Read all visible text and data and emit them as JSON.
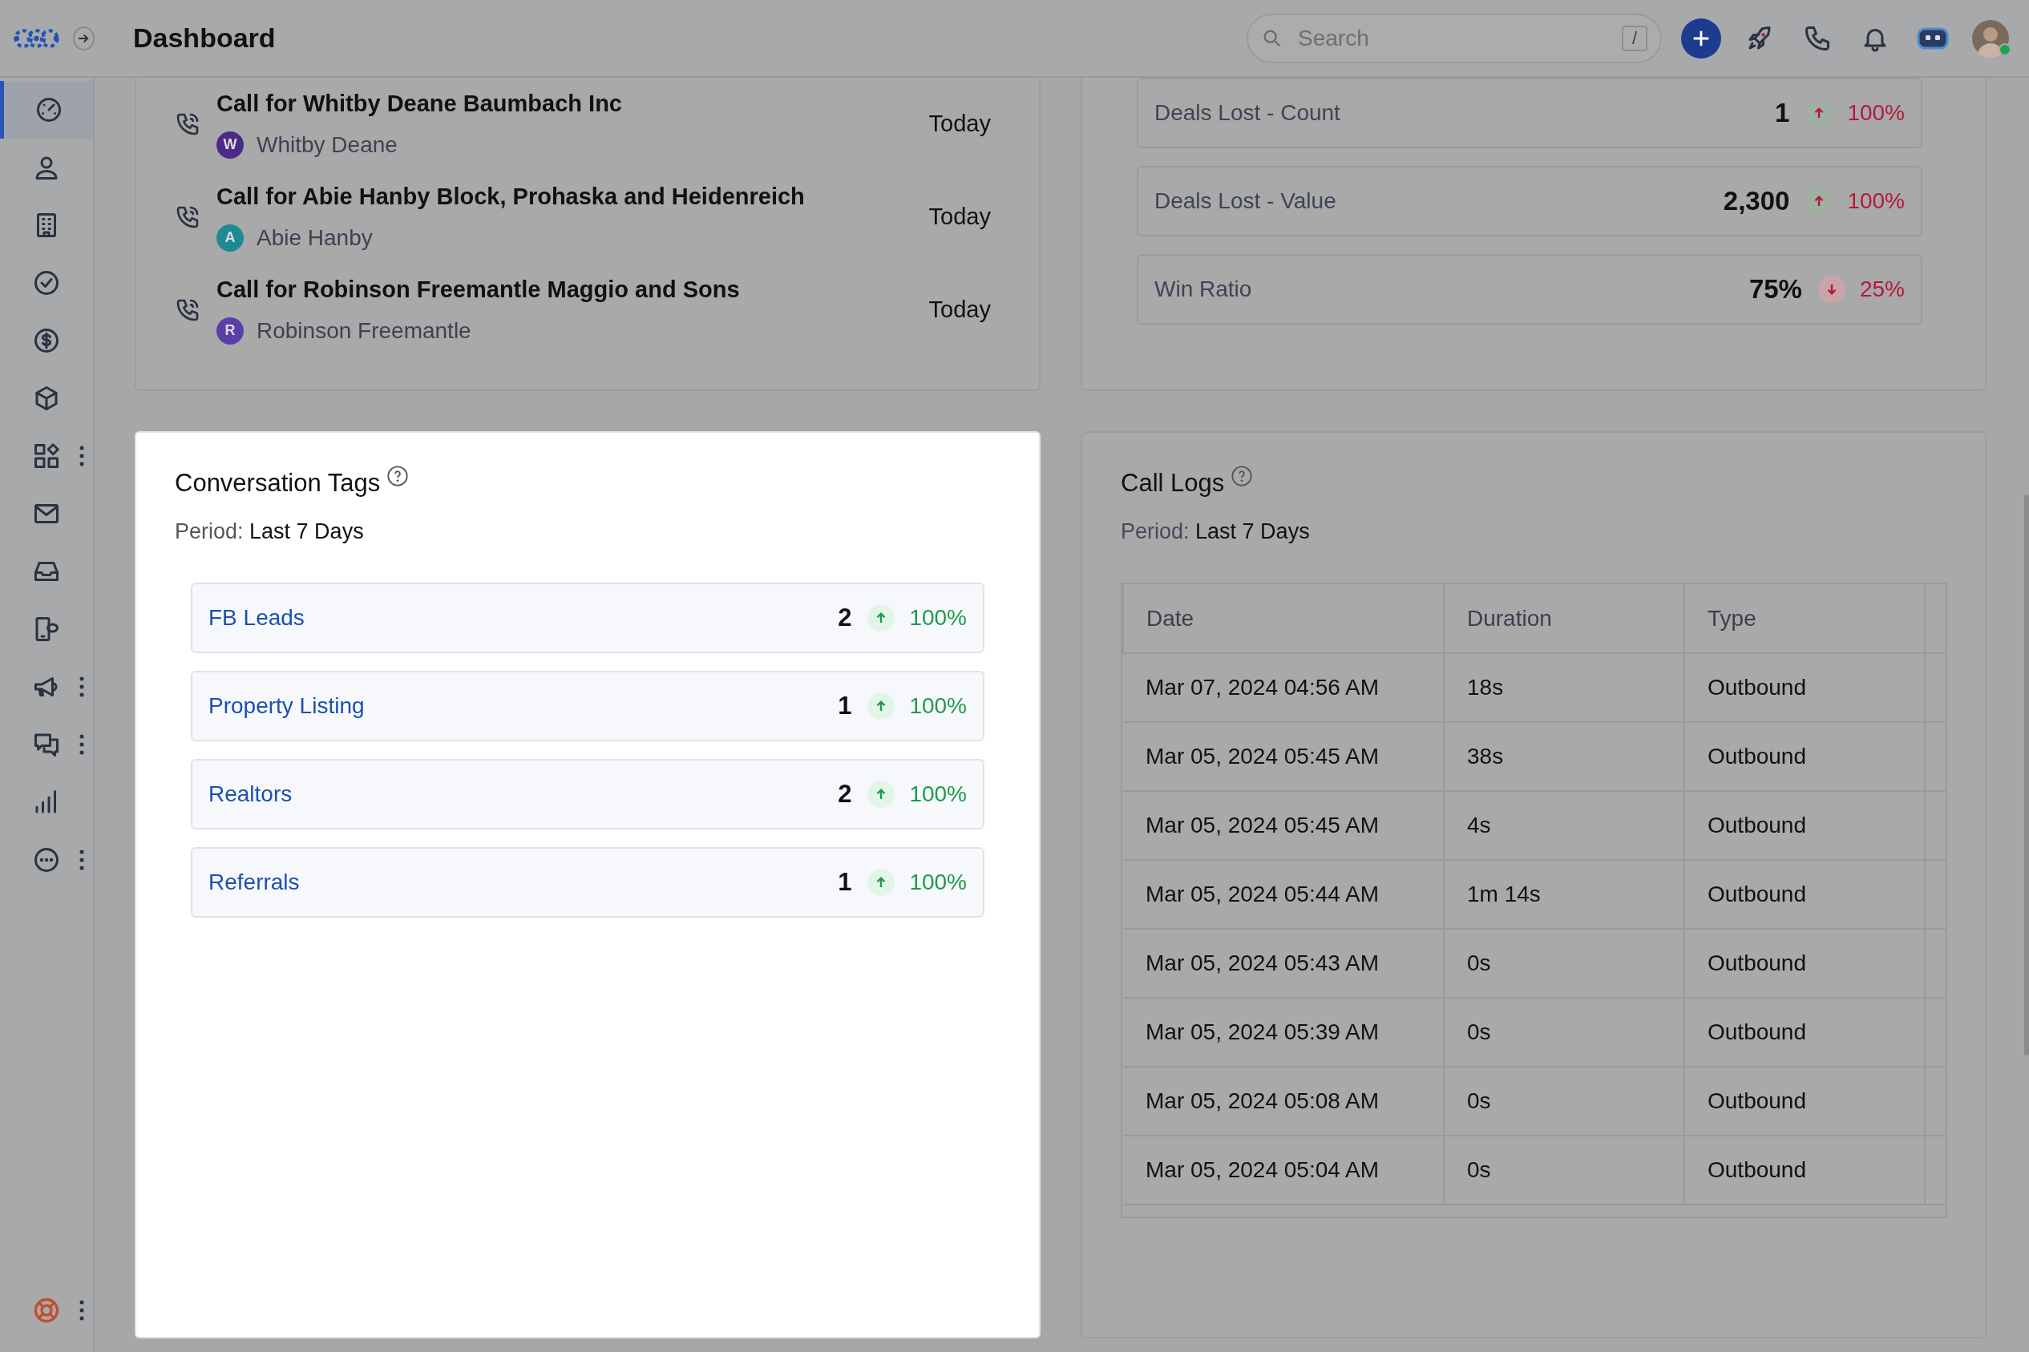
{
  "header": {
    "title": "Dashboard",
    "search": {
      "placeholder": "Search",
      "shortcut": "/"
    }
  },
  "sidebar": {
    "items": [
      {
        "selected": true,
        "more": false
      },
      {
        "selected": false,
        "more": false
      },
      {
        "selected": false,
        "more": false
      },
      {
        "selected": false,
        "more": false
      },
      {
        "selected": false,
        "more": false
      },
      {
        "selected": false,
        "more": false
      },
      {
        "selected": false,
        "more": true
      },
      {
        "selected": false,
        "more": false
      },
      {
        "selected": false,
        "more": false
      },
      {
        "selected": false,
        "more": false
      },
      {
        "selected": false,
        "more": true
      },
      {
        "selected": false,
        "more": true
      },
      {
        "selected": false,
        "more": false
      },
      {
        "selected": false,
        "more": true
      }
    ],
    "footer": {
      "more": true
    }
  },
  "activities": {
    "highlighted": false,
    "items": [
      {
        "title": "Call for Whitby Deane Baumbach Inc",
        "contact": "Whitby Deane",
        "initial": "W",
        "color": "#4b2a86",
        "when": "Today"
      },
      {
        "title": "Call for Abie Hanby Block, Prohaska and Heidenreich",
        "contact": "Abie Hanby",
        "initial": "A",
        "color": "#1f8a91",
        "when": "Today"
      },
      {
        "title": "Call for Robinson Freemantle Maggio and Sons",
        "contact": "Robinson Freemantle",
        "initial": "R",
        "color": "#5b3ea8",
        "when": "Today"
      }
    ]
  },
  "metrics": {
    "highlighted": false,
    "items": [
      {
        "label": "Deals Lost - Count",
        "value": "1",
        "increase": true,
        "good": false,
        "change": "100%"
      },
      {
        "label": "Deals Lost - Value",
        "value": "2,300",
        "increase": true,
        "good": false,
        "change": "100%"
      },
      {
        "label": "Win Ratio",
        "value": "75%",
        "increase": false,
        "good": false,
        "change": "25%"
      }
    ]
  },
  "conversation_tags": {
    "highlighted": true,
    "title": "Conversation Tags",
    "period_label": "Period:",
    "period": "Last 7 Days",
    "items": [
      {
        "name": "FB Leads",
        "count": "2",
        "increase": true,
        "good": true,
        "change": "100%"
      },
      {
        "name": "Property Listing",
        "count": "1",
        "increase": true,
        "good": true,
        "change": "100%"
      },
      {
        "name": "Realtors",
        "count": "2",
        "increase": true,
        "good": true,
        "change": "100%"
      },
      {
        "name": "Referrals",
        "count": "1",
        "increase": true,
        "good": true,
        "change": "100%"
      }
    ]
  },
  "call_logs": {
    "highlighted": false,
    "title": "Call Logs",
    "period_label": "Period:",
    "period": "Last 7 Days",
    "table": {
      "columns": [
        "Date",
        "Duration",
        "Type"
      ],
      "rows": [
        [
          "Mar 07, 2024 04:56 AM",
          "18s",
          "Outbound"
        ],
        [
          "Mar 05, 2024 05:45 AM",
          "38s",
          "Outbound"
        ],
        [
          "Mar 05, 2024 05:45 AM",
          "4s",
          "Outbound"
        ],
        [
          "Mar 05, 2024 05:44 AM",
          "1m 14s",
          "Outbound"
        ],
        [
          "Mar 05, 2024 05:43 AM",
          "0s",
          "Outbound"
        ],
        [
          "Mar 05, 2024 05:39 AM",
          "0s",
          "Outbound"
        ],
        [
          "Mar 05, 2024 05:08 AM",
          "0s",
          "Outbound"
        ],
        [
          "Mar 05, 2024 05:04 AM",
          "0s",
          "Outbound"
        ]
      ]
    }
  }
}
